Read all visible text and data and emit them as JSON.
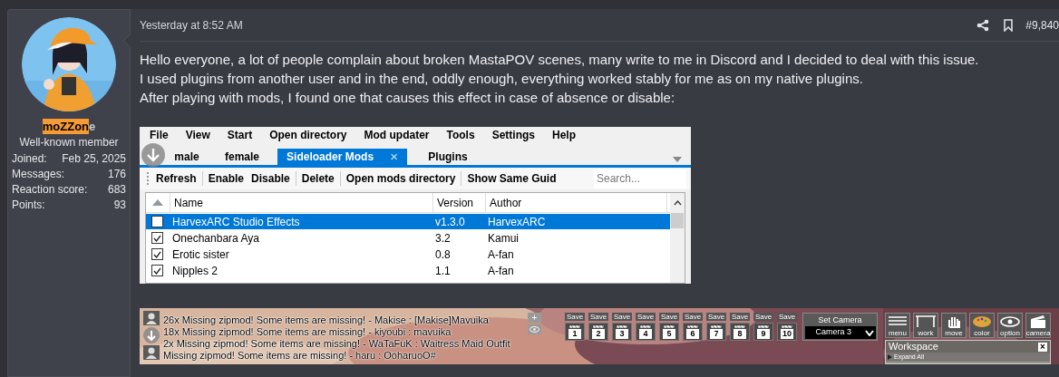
{
  "user": {
    "name_highlighted": "moZZon",
    "name_rest": "e",
    "title": "Well-known member",
    "stats": [
      {
        "label": "Joined:",
        "value": "Feb 25, 2025"
      },
      {
        "label": "Messages:",
        "value": "176"
      },
      {
        "label": "Reaction score:",
        "value": "683"
      },
      {
        "label": "Points:",
        "value": "93"
      }
    ]
  },
  "post": {
    "time": "Yesterday at 8:52 AM",
    "number": "#9,840",
    "lines": [
      "Hello everyone, a lot of people complain about broken MastaPOV scenes, many write to me in Discord and I decided to deal with this issue.",
      "I used plugins from another user and in the end, oddly enough, everything worked stably for me as on my native plugins.",
      "After playing with mods, I found one that causes this effect in case of absence or disable:"
    ]
  },
  "mod_manager": {
    "menus": [
      "File",
      "View",
      "Start",
      "Open directory",
      "Mod updater",
      "Tools",
      "Settings",
      "Help"
    ],
    "tabs": [
      {
        "label": "male",
        "selected": false,
        "closable": false
      },
      {
        "label": "female",
        "selected": false,
        "closable": false
      },
      {
        "label": "Sideloader Mods",
        "selected": true,
        "closable": true
      },
      {
        "label": "Plugins",
        "selected": false,
        "closable": false
      }
    ],
    "close_glyph": "×",
    "toolbar": [
      "Refresh",
      "Enable",
      "Disable",
      "Delete",
      "Open mods directory",
      "Show Same Guid"
    ],
    "search": {
      "placeholder": "Search..."
    },
    "columns": [
      "Name",
      "Version",
      "Author"
    ],
    "rows": [
      {
        "checked": false,
        "selected": true,
        "name": "HarvexARC Studio Effects",
        "version": "v1.3.0",
        "author": "HarvexARC"
      },
      {
        "checked": true,
        "selected": false,
        "name": "Onechanbara Aya",
        "version": "3.2",
        "author": "Kamui"
      },
      {
        "checked": true,
        "selected": false,
        "name": "Erotic sister",
        "version": "0.8",
        "author": "A-fan"
      },
      {
        "checked": true,
        "selected": false,
        "name": "Nipples 2",
        "version": "1.1",
        "author": "A-fan"
      }
    ]
  },
  "game_view": {
    "log": [
      "26x Missing zipmod! Some items are missing! - Makise : [Makise]Mavuika",
      "18x Missing zipmod! Some items are missing! - kiyoubi : mavuika",
      "2x Missing zipmod! Some items are missing! - WaTaFuK : Waitress Maid Outfit",
      "Missing zipmod! Some items are missing! - haru : OoharuoO#"
    ],
    "side_buttons": [
      "+"
    ],
    "save_slots": [
      {
        "label": "Save",
        "number": "1"
      },
      {
        "label": "Save",
        "number": "2"
      },
      {
        "label": "Save",
        "number": "3"
      },
      {
        "label": "Save",
        "number": "4"
      },
      {
        "label": "Save",
        "number": "5"
      },
      {
        "label": "Save",
        "number": "6"
      },
      {
        "label": "Save",
        "number": "7"
      },
      {
        "label": "Save",
        "number": "8"
      },
      {
        "label": "Save",
        "number": "9"
      },
      {
        "label": "Save",
        "number": "10"
      }
    ],
    "camera": {
      "label": "Set Camera",
      "value": "Camera 3"
    },
    "tools": [
      {
        "label": "menu",
        "kind": "list"
      },
      {
        "label": "work",
        "kind": "frame"
      },
      {
        "label": "move",
        "kind": "hand"
      },
      {
        "label": "color",
        "kind": "palette"
      },
      {
        "label": "option",
        "kind": "eye"
      },
      {
        "label": "camera",
        "kind": "clapper"
      }
    ],
    "workspace": {
      "title": "Workspace",
      "close_glyph": "×",
      "expand": "Expand All"
    }
  }
}
